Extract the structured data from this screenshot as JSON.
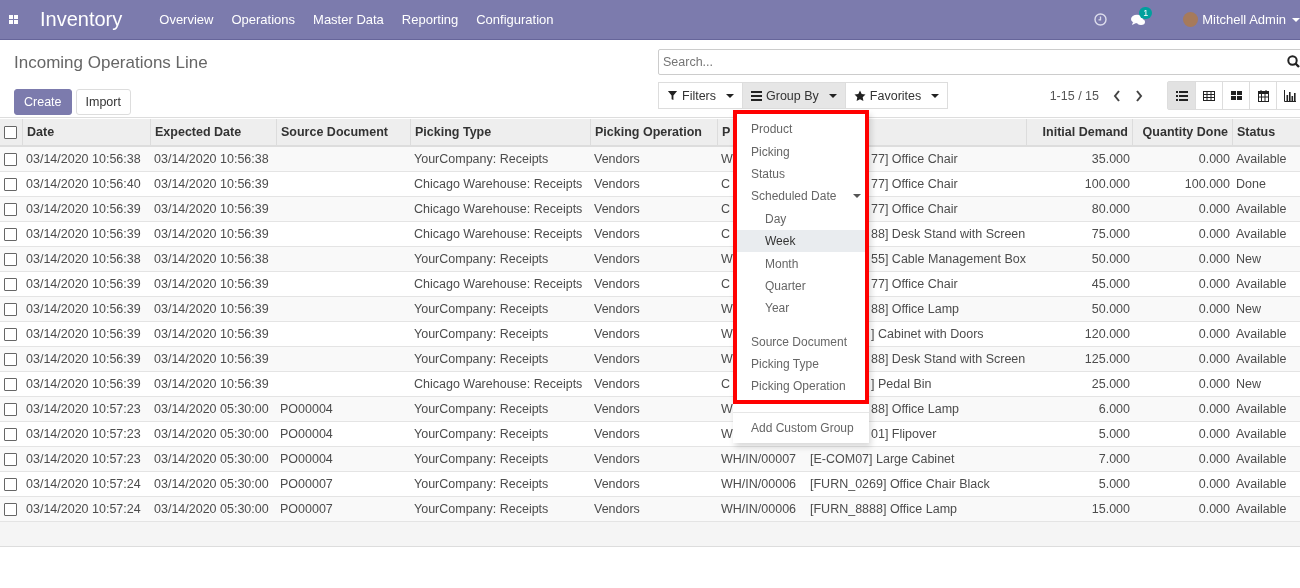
{
  "navbar": {
    "app_title": "Inventory",
    "menus": [
      "Overview",
      "Operations",
      "Master Data",
      "Reporting",
      "Configuration"
    ],
    "messages_badge": "1",
    "user_name": "Mitchell Admin"
  },
  "control_panel": {
    "title": "Incoming Operations Line",
    "buttons": [
      {
        "label": "Create",
        "kind": "primary"
      },
      {
        "label": "Import",
        "kind": "secondary"
      }
    ],
    "search": {
      "placeholder": "Search..."
    },
    "search_buttons": [
      {
        "label": "Filters",
        "open": false
      },
      {
        "label": "Group By",
        "open": true
      },
      {
        "label": "Favorites",
        "open": false
      }
    ],
    "pager": "1-15 / 15",
    "view_switcher": [
      {
        "selected": true
      },
      {
        "selected": false
      },
      {
        "selected": false
      },
      {
        "selected": false
      },
      {
        "selected": false
      }
    ]
  },
  "group_by_menu": {
    "highlighted": true,
    "items": [
      {
        "kind": "option",
        "label": "Product",
        "selected": false
      },
      {
        "kind": "option",
        "label": "Picking",
        "selected": false
      },
      {
        "kind": "option",
        "label": "Status",
        "selected": false
      },
      {
        "kind": "date",
        "label": "Scheduled Date",
        "expanded": true,
        "selected": false
      },
      {
        "kind": "sub",
        "label": "Day",
        "selected": false
      },
      {
        "kind": "sub",
        "label": "Week",
        "selected": true
      },
      {
        "kind": "sub",
        "label": "Month",
        "selected": false
      },
      {
        "kind": "sub",
        "label": "Quarter",
        "selected": false
      },
      {
        "kind": "sub",
        "label": "Year",
        "selected": false
      },
      {
        "kind": "gap"
      },
      {
        "kind": "option",
        "label": "Source Document",
        "selected": false
      },
      {
        "kind": "option",
        "label": "Picking Type",
        "selected": false
      },
      {
        "kind": "option",
        "label": "Picking Operation",
        "selected": false
      }
    ],
    "footer": "Add Custom Group"
  },
  "table": {
    "select_all_checked": false,
    "columns": [
      {
        "label": "Date"
      },
      {
        "label": "Expected Date"
      },
      {
        "label": "Source Document"
      },
      {
        "label": "Picking Type"
      },
      {
        "label": "Picking Operation"
      },
      {
        "label": "P"
      },
      {},
      {
        "label": "Initial Demand"
      },
      {
        "label": "Quantity Done"
      },
      {
        "label": "Status"
      }
    ],
    "rows": [
      {
        "checked": false,
        "cells": [
          "03/14/2020 10:56:38",
          "03/14/2020 10:56:38",
          "",
          "YourCompany: Receipts",
          "Vendors",
          "W",
          "77] Office Chair",
          "35.000",
          "0.000",
          "Available"
        ]
      },
      {
        "checked": false,
        "cells": [
          "03/14/2020 10:56:40",
          "03/14/2020 10:56:39",
          "",
          "Chicago Warehouse: Receipts",
          "Vendors",
          "C",
          "77] Office Chair",
          "100.000",
          "100.000",
          "Done"
        ]
      },
      {
        "checked": false,
        "cells": [
          "03/14/2020 10:56:39",
          "03/14/2020 10:56:39",
          "",
          "Chicago Warehouse: Receipts",
          "Vendors",
          "C",
          "77] Office Chair",
          "80.000",
          "0.000",
          "Available"
        ]
      },
      {
        "checked": false,
        "cells": [
          "03/14/2020 10:56:39",
          "03/14/2020 10:56:39",
          "",
          "Chicago Warehouse: Receipts",
          "Vendors",
          "C",
          "88] Desk Stand with Screen",
          "75.000",
          "0.000",
          "Available"
        ]
      },
      {
        "checked": false,
        "cells": [
          "03/14/2020 10:56:38",
          "03/14/2020 10:56:38",
          "",
          "YourCompany: Receipts",
          "Vendors",
          "W",
          "55] Cable Management Box",
          "50.000",
          "0.000",
          "New"
        ]
      },
      {
        "checked": false,
        "cells": [
          "03/14/2020 10:56:39",
          "03/14/2020 10:56:39",
          "",
          "Chicago Warehouse: Receipts",
          "Vendors",
          "C",
          "77] Office Chair",
          "45.000",
          "0.000",
          "Available"
        ]
      },
      {
        "checked": false,
        "cells": [
          "03/14/2020 10:56:39",
          "03/14/2020 10:56:39",
          "",
          "YourCompany: Receipts",
          "Vendors",
          "W",
          "88] Office Lamp",
          "50.000",
          "0.000",
          "New"
        ]
      },
      {
        "checked": false,
        "cells": [
          "03/14/2020 10:56:39",
          "03/14/2020 10:56:39",
          "",
          "YourCompany: Receipts",
          "Vendors",
          "W",
          "] Cabinet with Doors",
          "120.000",
          "0.000",
          "Available"
        ]
      },
      {
        "checked": false,
        "cells": [
          "03/14/2020 10:56:39",
          "03/14/2020 10:56:39",
          "",
          "YourCompany: Receipts",
          "Vendors",
          "W",
          "88] Desk Stand with Screen",
          "125.000",
          "0.000",
          "Available"
        ]
      },
      {
        "checked": false,
        "cells": [
          "03/14/2020 10:56:39",
          "03/14/2020 10:56:39",
          "",
          "Chicago Warehouse: Receipts",
          "Vendors",
          "C",
          "] Pedal Bin",
          "25.000",
          "0.000",
          "New"
        ]
      },
      {
        "checked": false,
        "cells": [
          "03/14/2020 10:57:23",
          "03/14/2020 05:30:00",
          "PO00004",
          "YourCompany: Receipts",
          "Vendors",
          "W",
          "88] Office Lamp",
          "6.000",
          "0.000",
          "Available"
        ]
      },
      {
        "checked": false,
        "cells": [
          "03/14/2020 10:57:23",
          "03/14/2020 05:30:00",
          "PO00004",
          "YourCompany: Receipts",
          "Vendors",
          "W",
          "01] Flipover",
          "5.000",
          "0.000",
          "Available"
        ]
      },
      {
        "checked": false,
        "cells": [
          "03/14/2020 10:57:23",
          "03/14/2020 05:30:00",
          "PO00004",
          "YourCompany: Receipts",
          "Vendors",
          "WH/IN/00007",
          "[E-COM07] Large Cabinet",
          "7.000",
          "0.000",
          "Available"
        ]
      },
      {
        "checked": false,
        "cells": [
          "03/14/2020 10:57:24",
          "03/14/2020 05:30:00",
          "PO00007",
          "YourCompany: Receipts",
          "Vendors",
          "WH/IN/00006",
          "[FURN_0269] Office Chair Black",
          "5.000",
          "0.000",
          "Available"
        ]
      },
      {
        "checked": false,
        "cells": [
          "03/14/2020 10:57:24",
          "03/14/2020 05:30:00",
          "PO00007",
          "YourCompany: Receipts",
          "Vendors",
          "WH/IN/00006",
          "[FURN_8888] Office Lamp",
          "15.000",
          "0.000",
          "Available"
        ]
      }
    ]
  }
}
